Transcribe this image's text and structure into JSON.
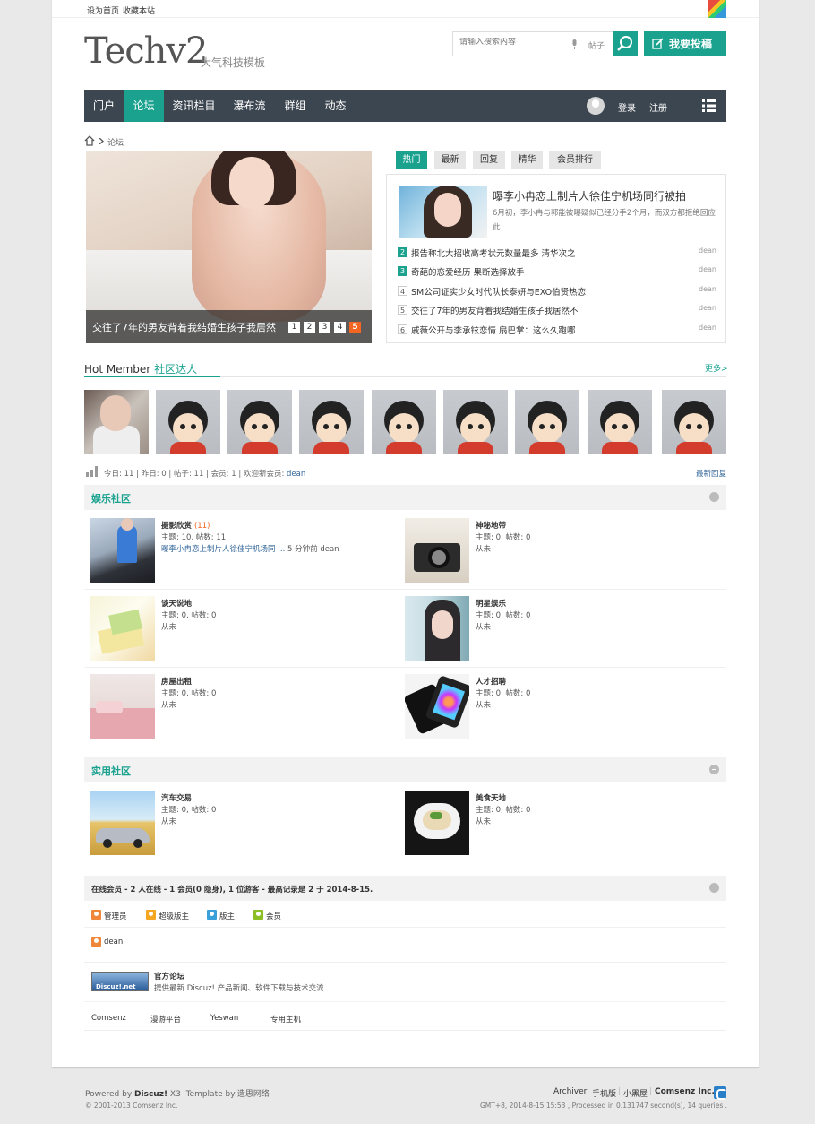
{
  "topbar": {
    "set_home": "设为首页",
    "bookmark": "收藏本站"
  },
  "header": {
    "logo": "Techv2",
    "logo_sub": "大气科技模板",
    "search_placeholder": "请输入搜索内容",
    "search_scope": "帖子",
    "post_button": "我要投稿"
  },
  "nav": {
    "items": [
      "门户",
      "论坛",
      "资讯栏目",
      "瀑布流",
      "群组",
      "动态"
    ],
    "active": "论坛",
    "login": "登录",
    "register": "注册"
  },
  "breadcrumb": {
    "current": "论坛"
  },
  "slider": {
    "caption": "交往了7年的男友背着我结婚生孩子我居然",
    "pages": [
      "1",
      "2",
      "3",
      "4",
      "5"
    ],
    "active_page": "5"
  },
  "tabs": {
    "items": [
      "热门",
      "最新",
      "回复",
      "精华",
      "会员排行"
    ],
    "active": "热门"
  },
  "featured": {
    "title": "曝李小冉恋上制片人徐佳宁机场同行被拍",
    "summary": "6月初，李小冉与郭能被曝疑似已经分手2个月，而双方都拒绝回应此"
  },
  "hot_list": [
    {
      "num": "2",
      "title": "报告称北大招收高考状元数量最多 清华次之",
      "author": "dean"
    },
    {
      "num": "3",
      "title": "奇葩的恋爱经历 果断选择放手",
      "author": "dean"
    },
    {
      "num": "4",
      "title": "SM公司证实少女时代队长泰妍与EXO伯贤热恋",
      "author": "dean"
    },
    {
      "num": "5",
      "title": "交往了7年的男友背着我结婚生孩子我居然不",
      "author": "dean"
    },
    {
      "num": "6",
      "title": "戚薇公开与李承铉恋情 扇巴掌：这么久跑哪",
      "author": "dean"
    }
  ],
  "hot_member": {
    "title_en": "Hot Member",
    "title_cn": "社区达人",
    "more": "更多>"
  },
  "stats": {
    "today_label": "今日:",
    "today": "11",
    "yesterday_label": "昨日:",
    "yesterday": "0",
    "posts_label": "帖子:",
    "posts": "11",
    "members_label": "会员:",
    "members": "1",
    "newest_label": "欢迎新会员:",
    "newest": "dean",
    "latest_reply": "最新回复"
  },
  "section1": {
    "title": "娱乐社区",
    "forums": [
      {
        "name": "摄影欣赏",
        "today": "(11)",
        "stats": "主题: 10, 帖数: 11",
        "last_link": "曝李小冉恋上制片人徐佳宁机场同 ...",
        "last_meta": "5 分钟前 dean"
      },
      {
        "name": "神秘地带",
        "stats": "主题: 0, 帖数: 0",
        "last": "从未"
      },
      {
        "name": "谈天说地",
        "stats": "主题: 0, 帖数: 0",
        "last": "从未"
      },
      {
        "name": "明星娱乐",
        "stats": "主题: 0, 帖数: 0",
        "last": "从未"
      },
      {
        "name": "房屋出租",
        "stats": "主题: 0, 帖数: 0",
        "last": "从未"
      },
      {
        "name": "人才招聘",
        "stats": "主题: 0, 帖数: 0",
        "last": "从未"
      }
    ]
  },
  "section2": {
    "title": "实用社区",
    "forums": [
      {
        "name": "汽车交易",
        "stats": "主题: 0, 帖数: 0",
        "last": "从未"
      },
      {
        "name": "美食天地",
        "stats": "主题: 0, 帖数: 0",
        "last": "从未"
      }
    ]
  },
  "online": {
    "text": "在线会员 - 2 人在线 - 1 会员(0 隐身), 1 位游客 - 最高记录是 2 于 2014-8-15.",
    "legend": [
      "管理员",
      "超级版主",
      "版主",
      "会员"
    ],
    "user": "dean",
    "legend_colors": [
      "#f0863a",
      "#f5a623",
      "#3aa0d9",
      "#8cbf26"
    ]
  },
  "official": {
    "logo_text": "Discuz!.net",
    "name": "官方论坛",
    "desc": "提供最新 Discuz! 产品新闻、软件下载与技术交流",
    "links": [
      "Comsenz",
      "漫游平台",
      "Yeswan",
      "专用主机"
    ]
  },
  "footer": {
    "powered": "Powered by",
    "brand": "Discuz!",
    "ver": "X3",
    "template": "Template by:造思网络",
    "copyright": "© 2001-2013 Comsenz Inc.",
    "links": [
      "Archiver",
      "手机版",
      "小黑屋",
      "Comsenz Inc."
    ],
    "runtime": "GMT+8, 2014-8-15 15:53 , Processed in 0.131747 second(s), 14 queries ."
  },
  "colors": {
    "accent": "#1aa28f",
    "nav_bg": "#3c4650",
    "orange": "#f26522"
  }
}
